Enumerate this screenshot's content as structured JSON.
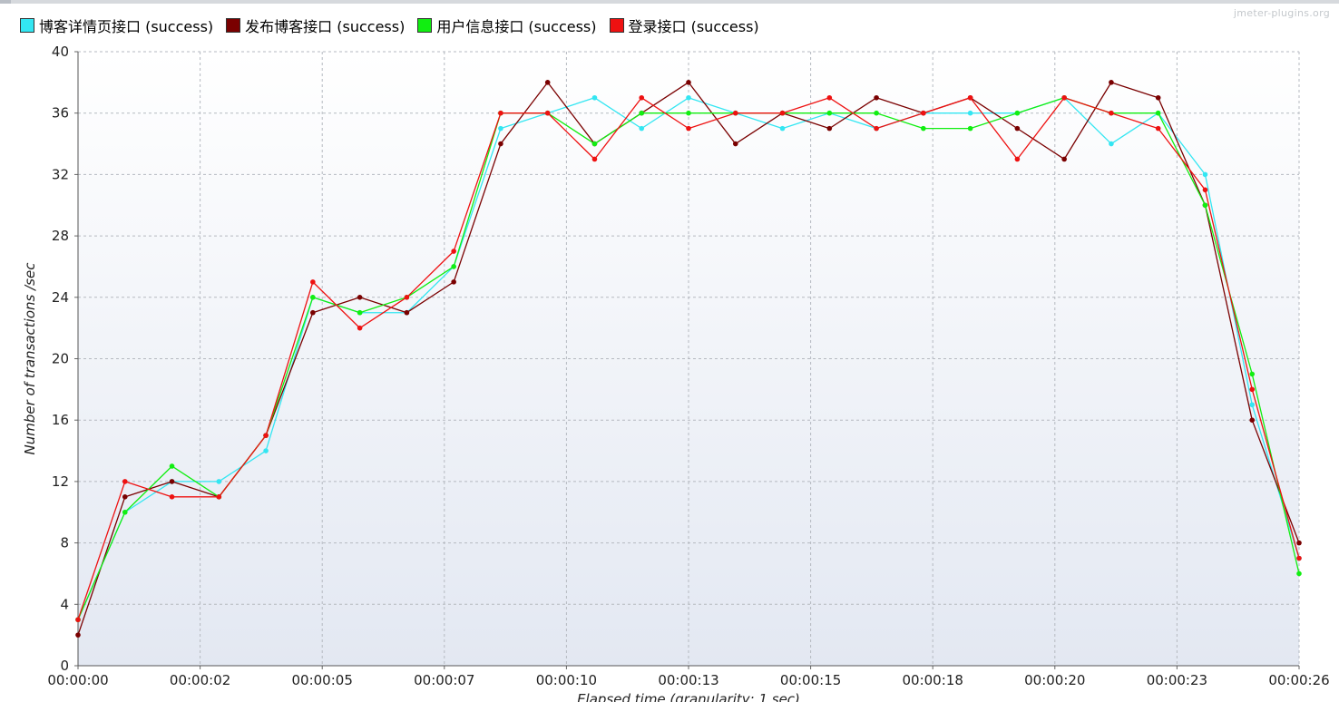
{
  "watermark": "jmeter-plugins.org",
  "chart_data": {
    "type": "line",
    "title": "",
    "ylabel": "Number of transactions /sec",
    "xlabel": "Elapsed time (granularity: 1 sec)",
    "ylim": [
      0,
      40
    ],
    "yticks": [
      0,
      4,
      8,
      12,
      16,
      20,
      24,
      28,
      32,
      36,
      40
    ],
    "x": [
      0,
      1,
      2,
      3,
      4,
      5,
      6,
      7,
      8,
      9,
      10,
      11,
      12,
      13,
      14,
      15,
      16,
      17,
      18,
      19,
      20,
      21,
      22,
      23,
      24,
      25,
      26
    ],
    "xlim": [
      0,
      26
    ],
    "xticks": [
      {
        "x": 0,
        "label": "00:00:00"
      },
      {
        "x": 2.6,
        "label": "00:00:02"
      },
      {
        "x": 5.2,
        "label": "00:00:05"
      },
      {
        "x": 7.8,
        "label": "00:00:07"
      },
      {
        "x": 10.4,
        "label": "00:00:10"
      },
      {
        "x": 13,
        "label": "00:00:13"
      },
      {
        "x": 15.6,
        "label": "00:00:15"
      },
      {
        "x": 18.2,
        "label": "00:00:18"
      },
      {
        "x": 20.8,
        "label": "00:00:20"
      },
      {
        "x": 23.4,
        "label": "00:00:23"
      },
      {
        "x": 26,
        "label": "00:00:26"
      }
    ],
    "grid": true,
    "legend_position": "top-left",
    "series": [
      {
        "name": "博客详情页接口 (success)",
        "color": "#33e6f2",
        "values": [
          3,
          10,
          12,
          12,
          14,
          24,
          23,
          23,
          26,
          35,
          36,
          37,
          35,
          37,
          36,
          35,
          36,
          35,
          36,
          36,
          36,
          37,
          34,
          36,
          32,
          17,
          7
        ]
      },
      {
        "name": "发布博客接口 (success)",
        "color": "#7a0000",
        "values": [
          2,
          11,
          12,
          11,
          15,
          23,
          24,
          23,
          25,
          34,
          38,
          34,
          36,
          38,
          34,
          36,
          35,
          37,
          36,
          37,
          35,
          33,
          38,
          37,
          30,
          16,
          8
        ]
      },
      {
        "name": "用户信息接口 (success)",
        "color": "#11ee11",
        "values": [
          3,
          10,
          13,
          11,
          15,
          24,
          23,
          24,
          26,
          36,
          36,
          34,
          36,
          36,
          36,
          36,
          36,
          36,
          35,
          35,
          36,
          37,
          36,
          36,
          30,
          19,
          6
        ]
      },
      {
        "name": "登录接口 (success)",
        "color": "#ee1111",
        "values": [
          3,
          12,
          11,
          11,
          15,
          25,
          22,
          24,
          27,
          36,
          36,
          33,
          37,
          35,
          36,
          36,
          37,
          35,
          36,
          37,
          33,
          37,
          36,
          35,
          31,
          18,
          7
        ]
      }
    ]
  }
}
